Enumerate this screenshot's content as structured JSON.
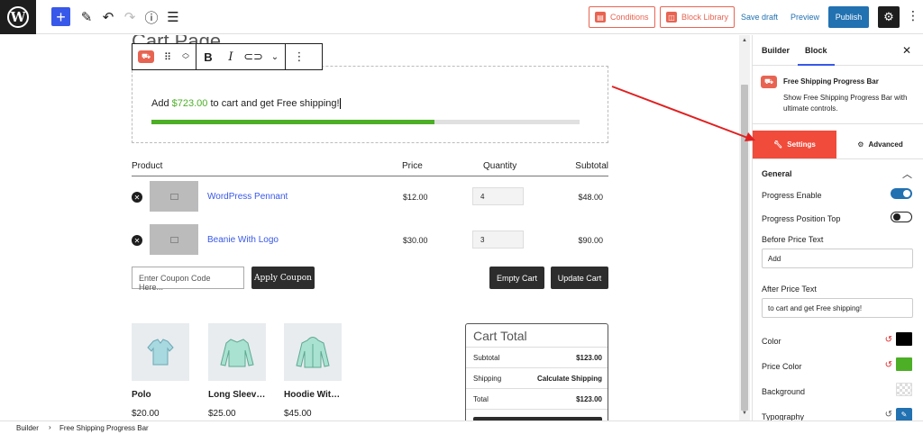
{
  "topbar": {
    "conditions_label": "Conditions",
    "block_library_label": "Block Library",
    "save_draft_label": "Save draft",
    "preview_label": "Preview",
    "publish_label": "Publish"
  },
  "canvas": {
    "page_title": "Cart Page",
    "progress": {
      "before_text": "Add",
      "price": "$723.00",
      "after_text": "to cart and get Free shipping!",
      "fill_fraction": 0.66,
      "colors": {
        "fill": "#4caf26",
        "track": "#e0e0e0",
        "price": "#4caf26"
      }
    },
    "table": {
      "headers": {
        "product": "Product",
        "price": "Price",
        "quantity": "Quantity",
        "subtotal": "Subtotal"
      },
      "rows": [
        {
          "name": "WordPress Pennant",
          "price": "$12.00",
          "qty": "4",
          "subtotal": "$48.00"
        },
        {
          "name": "Beanie With Logo",
          "price": "$30.00",
          "qty": "3",
          "subtotal": "$90.00"
        }
      ]
    },
    "coupon_placeholder": "Enter Coupon Code Here...",
    "apply_coupon": "Apply Coupon",
    "empty_cart": "Empty Cart",
    "update_cart": "Update Cart",
    "products": [
      {
        "name": "Polo",
        "price": "$20.00"
      },
      {
        "name": "Long Sleev…",
        "price": "$25.00"
      },
      {
        "name": "Hoodie Wit…",
        "price": "$45.00"
      }
    ],
    "cart_total": {
      "title": "Cart Total",
      "subtotal_label": "Subtotal",
      "subtotal_value": "$123.00",
      "shipping_label": "Shipping",
      "shipping_value": "Calculate Shipping",
      "total_label": "Total",
      "total_value": "$123.00"
    }
  },
  "sidebar": {
    "tabs": {
      "builder": "Builder",
      "block": "Block"
    },
    "block_title": "Free Shipping Progress Bar",
    "block_desc": "Show Free Shipping Progress Bar with ultimate controls.",
    "settings_tab": "Settings",
    "advanced_tab": "Advanced",
    "section": "General",
    "progress_enable": "Progress Enable",
    "progress_position_top": "Progress Position Top",
    "before_price_text_label": "Before Price Text",
    "before_price_text_value": "Add",
    "after_price_text_label": "After Price Text",
    "after_price_text_value": "to cart and get Free shipping!",
    "color_label": "Color",
    "price_color_label": "Price Color",
    "background_label": "Background",
    "typography_label": "Typography",
    "colors": {
      "color": "#000000",
      "price_color": "#4caf26",
      "accent": "#f04b3b"
    }
  },
  "footer": {
    "crumb_builder": "Builder",
    "crumb_block": "Free Shipping Progress Bar"
  }
}
